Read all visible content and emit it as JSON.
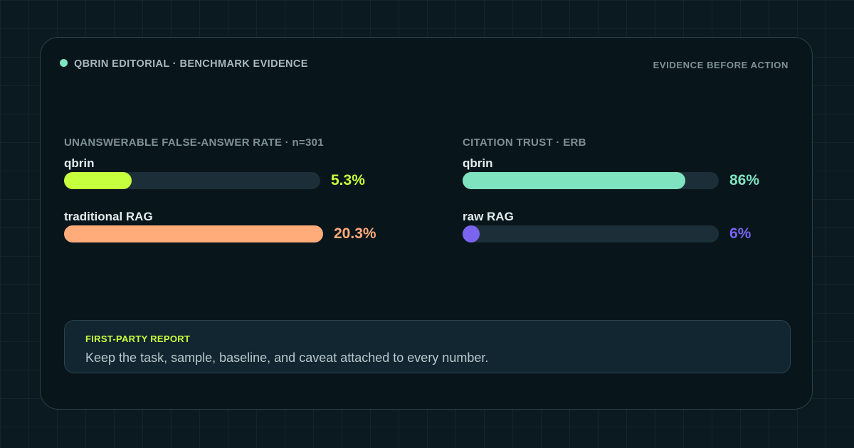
{
  "header": {
    "brand": "QBRIN EDITORIAL · BENCHMARK EVIDENCE",
    "tagline": "EVIDENCE BEFORE ACTION",
    "dot_color": "#7fe3c0"
  },
  "chart_data": [
    {
      "type": "bar",
      "orientation": "horizontal",
      "title": "UNANSWERABLE FALSE-ANSWER RATE · n=301",
      "categories": [
        "qbrin",
        "traditional RAG"
      ],
      "values": [
        5.3,
        20.3
      ],
      "value_labels": [
        "5.3%",
        "20.3%"
      ],
      "colors": [
        "#c6ff3d",
        "#ffab7a"
      ],
      "xlim": [
        0,
        20.3
      ]
    },
    {
      "type": "bar",
      "orientation": "horizontal",
      "title": "CITATION TRUST · ERB",
      "categories": [
        "qbrin",
        "raw RAG"
      ],
      "values": [
        86,
        6
      ],
      "value_labels": [
        "86%",
        "6%"
      ],
      "colors": [
        "#7fe3c0",
        "#7b64f0"
      ],
      "xlim": [
        0,
        100
      ]
    }
  ],
  "note": {
    "label": "FIRST-PARTY REPORT",
    "text": "Keep the task, sample, baseline, and caveat attached to every number."
  }
}
